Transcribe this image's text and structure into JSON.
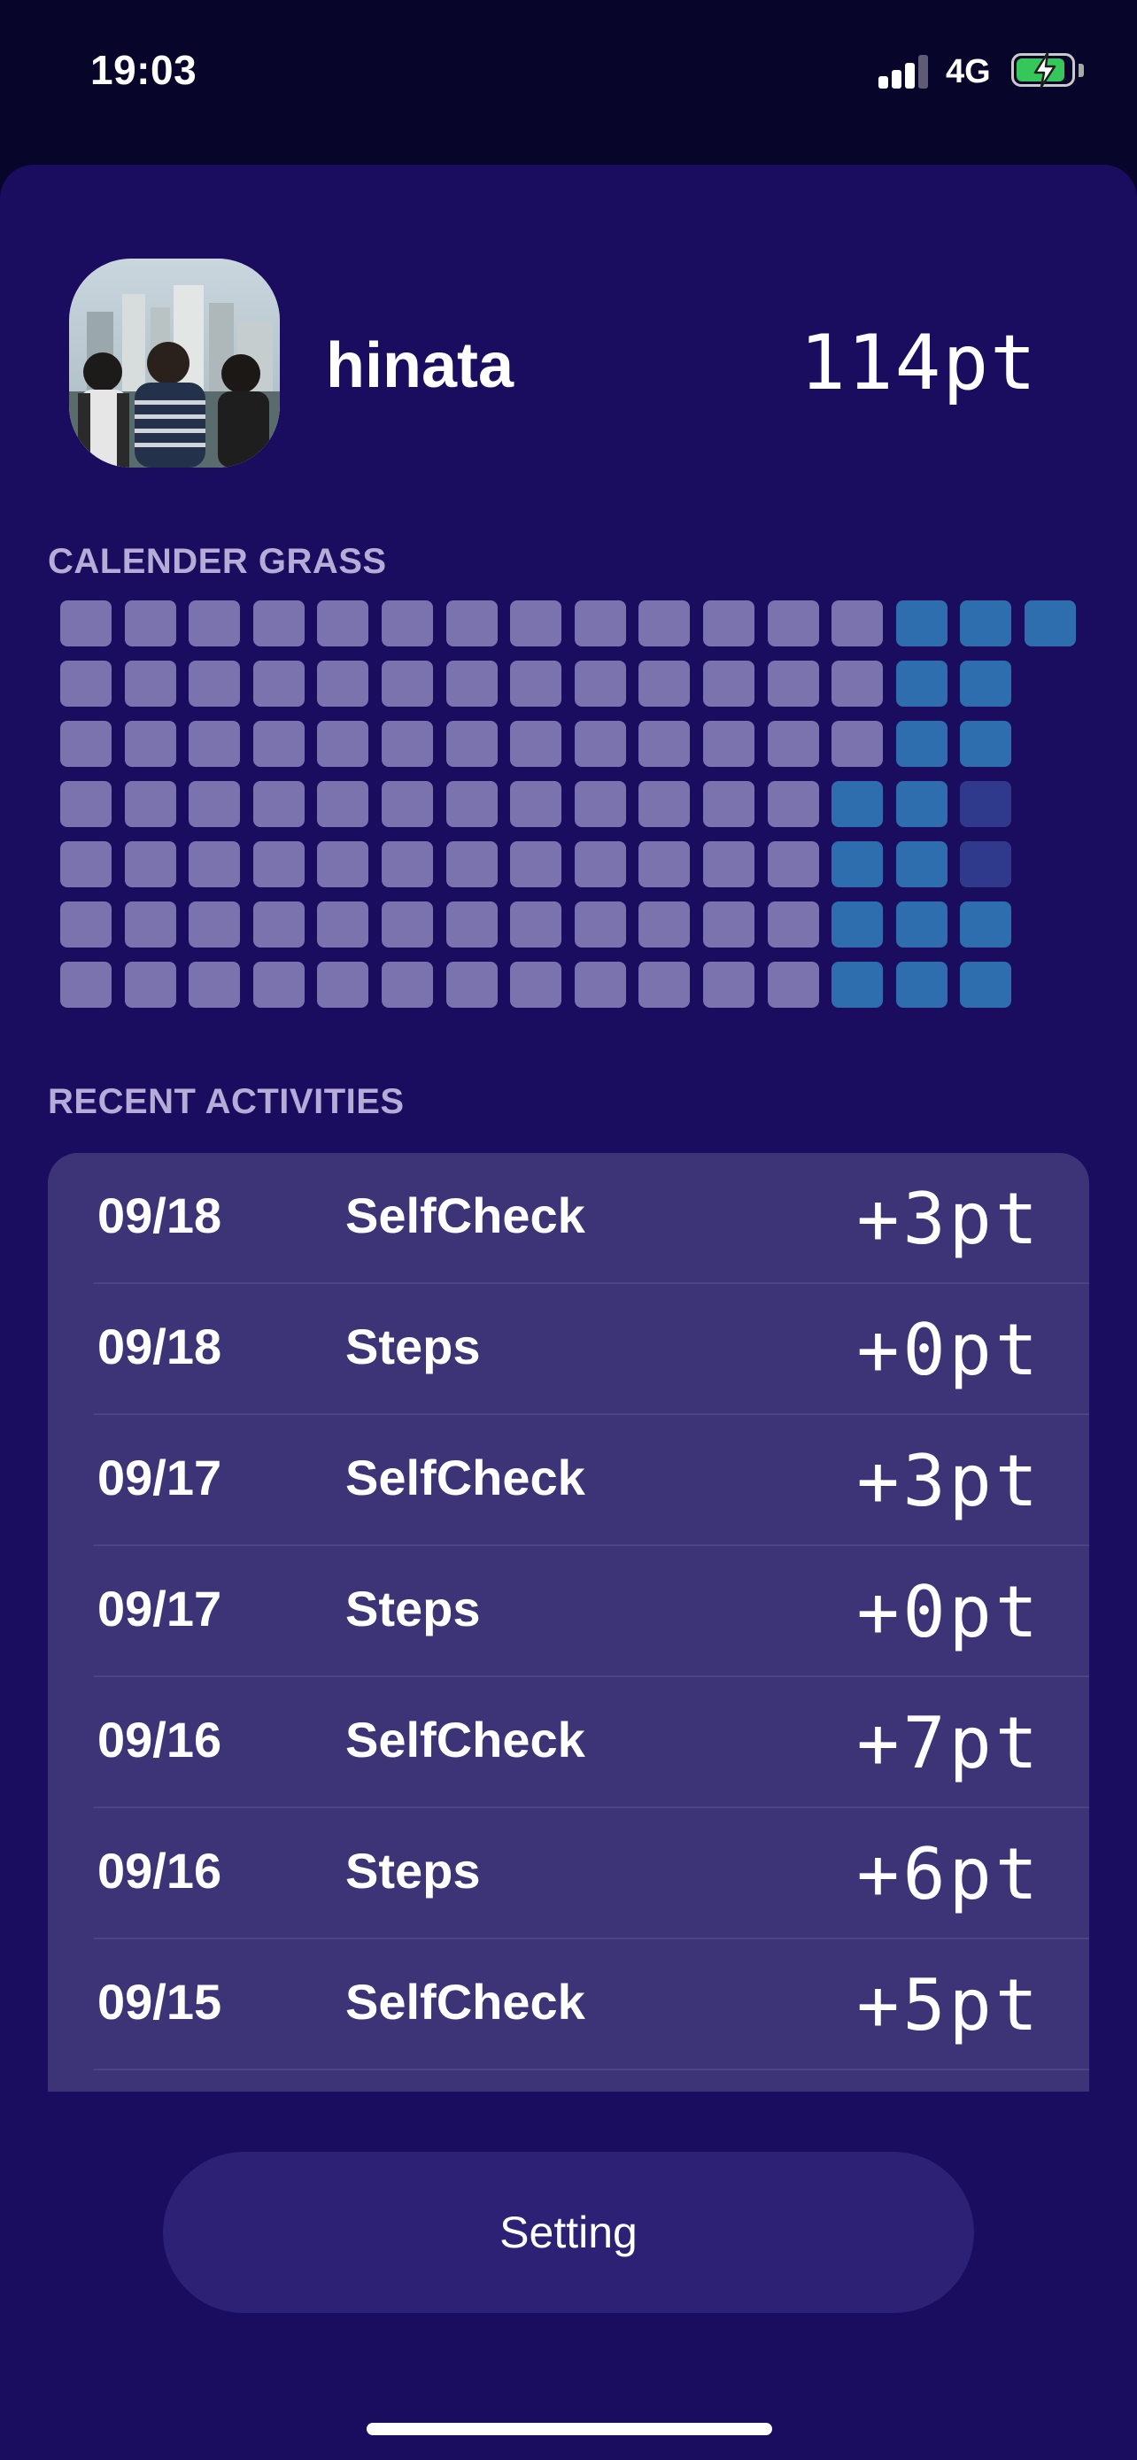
{
  "status_bar": {
    "time": "19:03",
    "network": "4G",
    "battery_level": 0.9,
    "battery_color": "#35c759"
  },
  "profile": {
    "username": "hinata",
    "points": "114pt",
    "avatar_icon": "profile-photo"
  },
  "calendar_grass": {
    "label": "CALENDER GRASS",
    "colors": {
      "empty": "#7b73ad",
      "active": "#2e6eaf",
      "partial": "#303a8c"
    },
    "rows": [
      [
        "e",
        "e",
        "e",
        "e",
        "e",
        "e",
        "e",
        "e",
        "e",
        "e",
        "e",
        "e",
        "e",
        "a",
        "a",
        "a"
      ],
      [
        "e",
        "e",
        "e",
        "e",
        "e",
        "e",
        "e",
        "e",
        "e",
        "e",
        "e",
        "e",
        "e",
        "a",
        "a"
      ],
      [
        "e",
        "e",
        "e",
        "e",
        "e",
        "e",
        "e",
        "e",
        "e",
        "e",
        "e",
        "e",
        "e",
        "a",
        "a"
      ],
      [
        "e",
        "e",
        "e",
        "e",
        "e",
        "e",
        "e",
        "e",
        "e",
        "e",
        "e",
        "e",
        "a",
        "a",
        "p"
      ],
      [
        "e",
        "e",
        "e",
        "e",
        "e",
        "e",
        "e",
        "e",
        "e",
        "e",
        "e",
        "e",
        "a",
        "a",
        "p"
      ],
      [
        "e",
        "e",
        "e",
        "e",
        "e",
        "e",
        "e",
        "e",
        "e",
        "e",
        "e",
        "e",
        "a",
        "a",
        "a"
      ],
      [
        "e",
        "e",
        "e",
        "e",
        "e",
        "e",
        "e",
        "e",
        "e",
        "e",
        "e",
        "e",
        "a",
        "a",
        "a"
      ]
    ]
  },
  "recent_activities": {
    "label": "RECENT ACTIVITIES",
    "items": [
      {
        "date": "09/18",
        "name": "SelfCheck",
        "points": "+3pt"
      },
      {
        "date": "09/18",
        "name": "Steps",
        "points": "+0pt"
      },
      {
        "date": "09/17",
        "name": "SelfCheck",
        "points": "+3pt"
      },
      {
        "date": "09/17",
        "name": "Steps",
        "points": "+0pt"
      },
      {
        "date": "09/16",
        "name": "SelfCheck",
        "points": "+7pt"
      },
      {
        "date": "09/16",
        "name": "Steps",
        "points": "+6pt"
      },
      {
        "date": "09/15",
        "name": "SelfCheck",
        "points": "+5pt"
      }
    ]
  },
  "setting_button": {
    "label": "Setting"
  }
}
